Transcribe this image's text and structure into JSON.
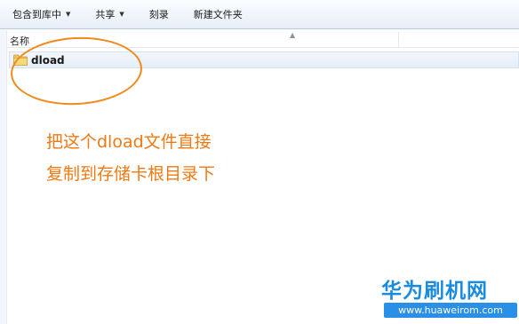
{
  "toolbar": {
    "items": [
      {
        "label": "包含到库中",
        "has_dropdown": true
      },
      {
        "label": "共享",
        "has_dropdown": true
      },
      {
        "label": "刻录",
        "has_dropdown": false
      },
      {
        "label": "新建文件夹",
        "has_dropdown": false
      }
    ]
  },
  "file_list": {
    "column_name": "名称",
    "files": [
      {
        "name": "dload",
        "icon": "folder-icon"
      }
    ]
  },
  "annotation": {
    "line1": "把这个dload文件直接",
    "line2": "复制到存储卡根目录下",
    "color": "#ef7a13"
  },
  "watermark": {
    "title": "华为刷机网",
    "url": "www.huaweirom.com"
  }
}
